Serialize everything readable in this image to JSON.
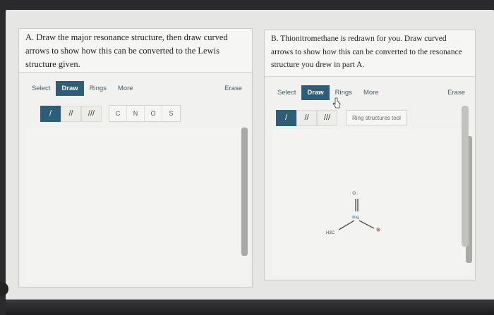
{
  "panel_a": {
    "question": "A. Draw the major resonance structure, then draw curved arrows to show how this can be converted to the Lewis structure given.",
    "toolbar": {
      "select": "Select",
      "draw": "Draw",
      "rings": "Rings",
      "more": "More",
      "erase": "Erase"
    },
    "bonds": {
      "single": "/",
      "double": "//",
      "triple": "///"
    },
    "atoms": [
      "C",
      "N",
      "O",
      "S"
    ]
  },
  "panel_b": {
    "question": "B. Thionitromethane is redrawn for you. Draw curved arrows to show how this can be converted to the resonance structure you drew in part A.",
    "toolbar": {
      "select": "Select",
      "draw": "Draw",
      "rings": "Rings",
      "more": "More",
      "erase": "Erase"
    },
    "bonds": {
      "single": "/",
      "double": "//",
      "triple": "///"
    },
    "ring_tool": "Ring structures tool",
    "molecule": {
      "top_atom": ": O :",
      "center_atom": "N",
      "left_group": "H3C",
      "right_atom": "S"
    }
  }
}
